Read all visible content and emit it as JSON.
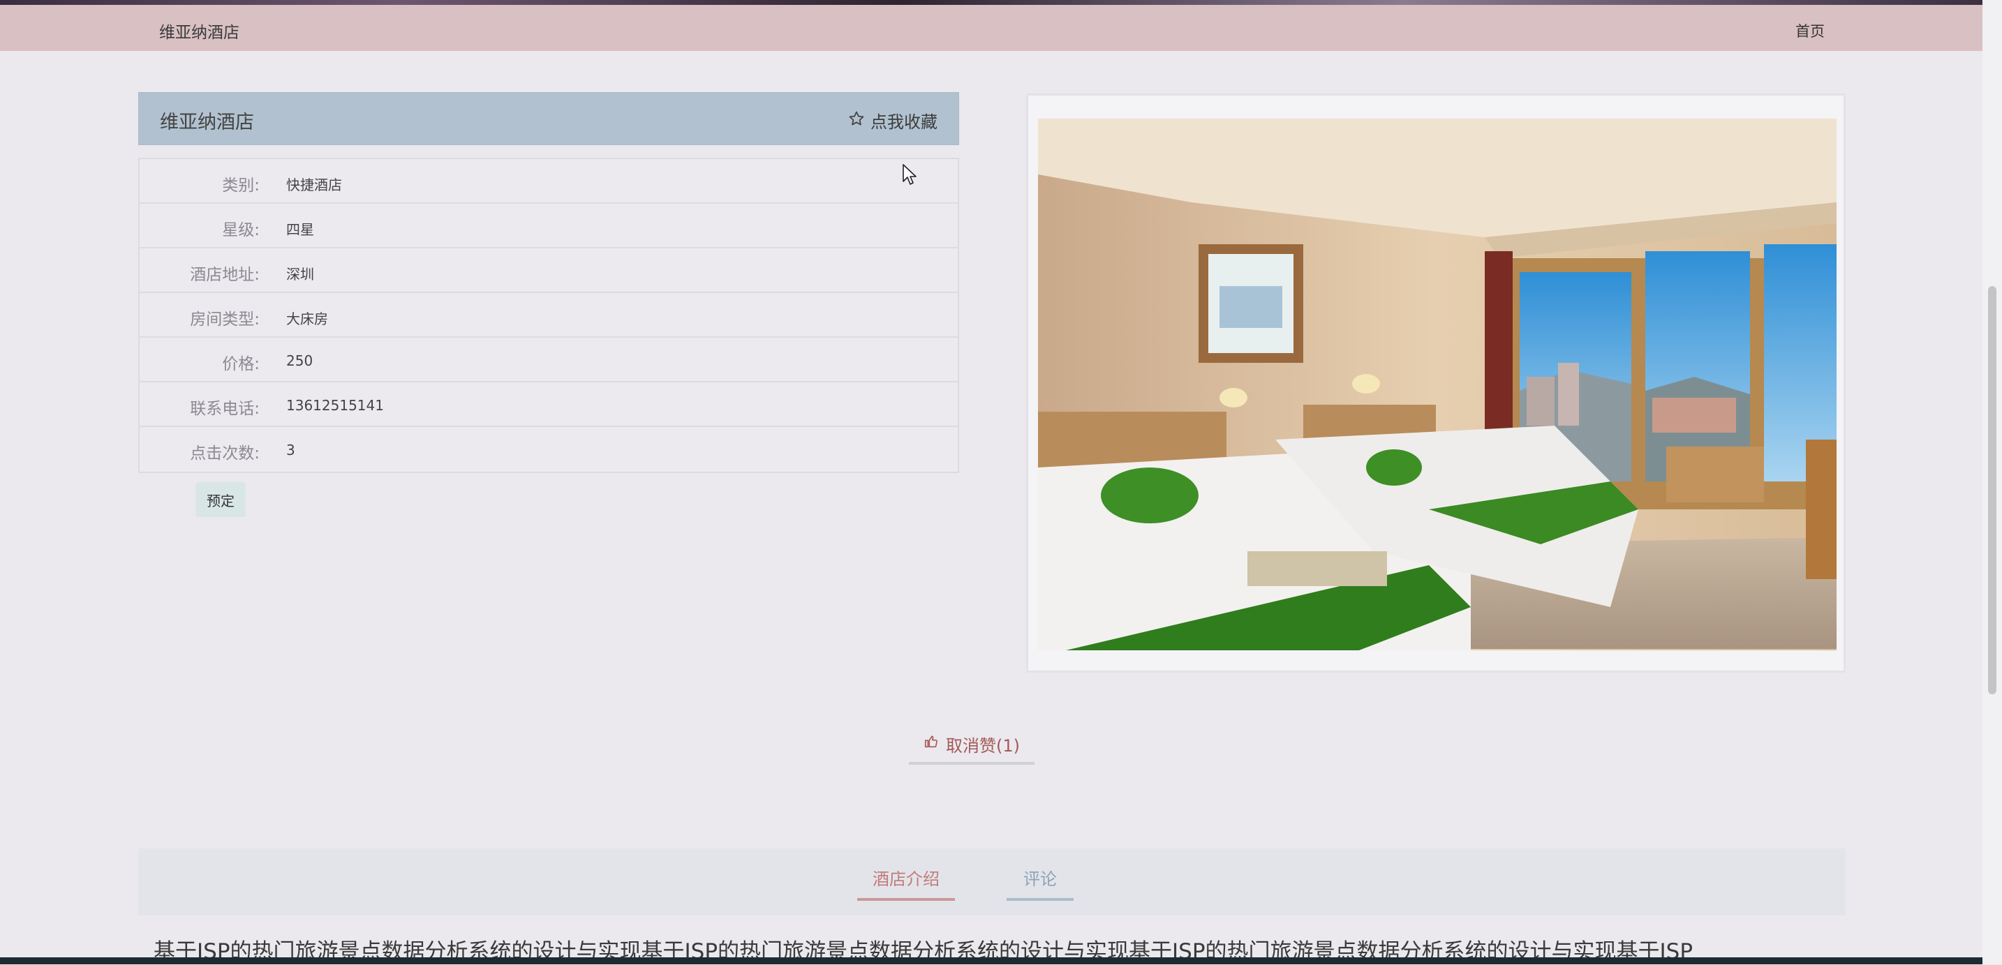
{
  "navbar": {
    "brand": "维亚纳酒店",
    "home_link": "首页"
  },
  "hotel": {
    "name": "维亚纳酒店",
    "favorite_label": "点我收藏",
    "fields": [
      {
        "label": "类别:",
        "value": "快捷酒店"
      },
      {
        "label": "星级:",
        "value": "四星"
      },
      {
        "label": "酒店地址:",
        "value": "深圳"
      },
      {
        "label": "房间类型:",
        "value": "大床房"
      },
      {
        "label": "价格:",
        "value": "250"
      },
      {
        "label": "联系电话:",
        "value": "13612515141"
      },
      {
        "label": "点击次数:",
        "value": "3"
      }
    ],
    "book_label": "预定"
  },
  "like": {
    "label": "取消赞(1)"
  },
  "tabs": [
    {
      "label": "酒店介绍"
    },
    {
      "label": "评论"
    }
  ],
  "description": "基于JSP的热门旅游景点数据分析系统的设计与实现基于JSP的热门旅游景点数据分析系统的设计与实现基于JSP的热门旅游景点数据分析系统的设计与实现基于JSP",
  "icons": {
    "favorite": "star-outline-icon",
    "like": "thumbs-up-icon"
  },
  "colors": {
    "navbar": "#d9c0c3",
    "panel_header": "#b1c1cf",
    "like_text": "#a35a58",
    "active_tab": "#c07c79"
  }
}
